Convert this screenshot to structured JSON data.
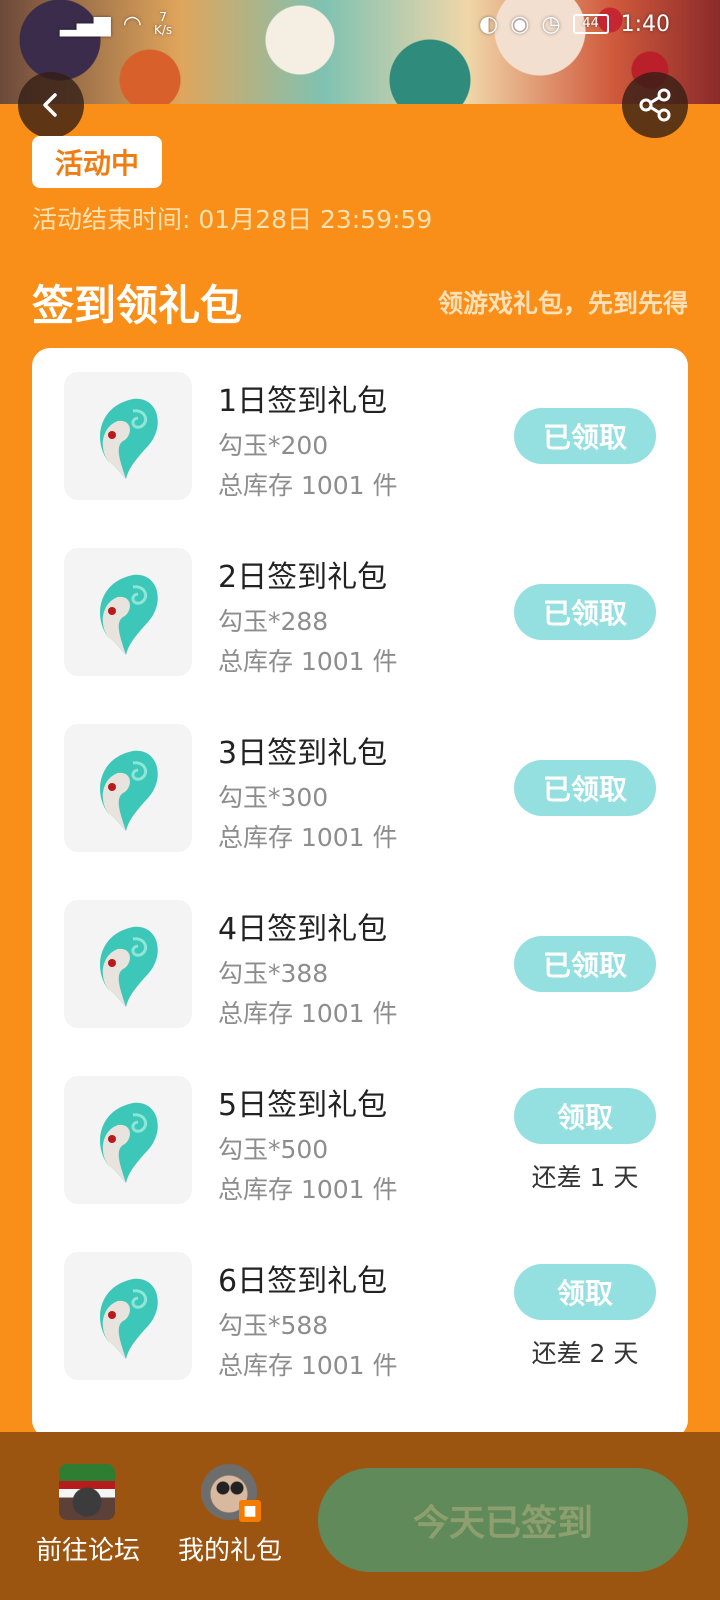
{
  "status_bar": {
    "net_speed_value": "7",
    "net_speed_unit": "K/s",
    "battery": "44",
    "time": "1:40"
  },
  "activity": {
    "status_label": "活动中",
    "end_time_text": "活动结束时间: 01月28日 23:59:59"
  },
  "section": {
    "title": "签到领礼包",
    "slogan": "领游戏礼包，先到先得"
  },
  "gifts": [
    {
      "name": "1日签到礼包",
      "content": "勾玉*200",
      "stock": "总库存 1001 件",
      "button": "已领取",
      "remain": ""
    },
    {
      "name": "2日签到礼包",
      "content": "勾玉*288",
      "stock": "总库存 1001 件",
      "button": "已领取",
      "remain": ""
    },
    {
      "name": "3日签到礼包",
      "content": "勾玉*300",
      "stock": "总库存 1001 件",
      "button": "已领取",
      "remain": ""
    },
    {
      "name": "4日签到礼包",
      "content": "勾玉*388",
      "stock": "总库存 1001 件",
      "button": "已领取",
      "remain": ""
    },
    {
      "name": "5日签到礼包",
      "content": "勾玉*500",
      "stock": "总库存 1001 件",
      "button": "领取",
      "remain": "还差 1 天"
    },
    {
      "name": "6日签到礼包",
      "content": "勾玉*588",
      "stock": "总库存 1001 件",
      "button": "领取",
      "remain": "还差 2 天"
    }
  ],
  "bottom_bar": {
    "forum_label": "前往论坛",
    "my_gifts_label": "我的礼包",
    "checkin_label": "今天已签到"
  },
  "colors": {
    "page_background": "#f98f18",
    "claim_button": "#94dfe0",
    "checkin_button": "#618a5a",
    "bottom_bar": "#9c5510"
  }
}
